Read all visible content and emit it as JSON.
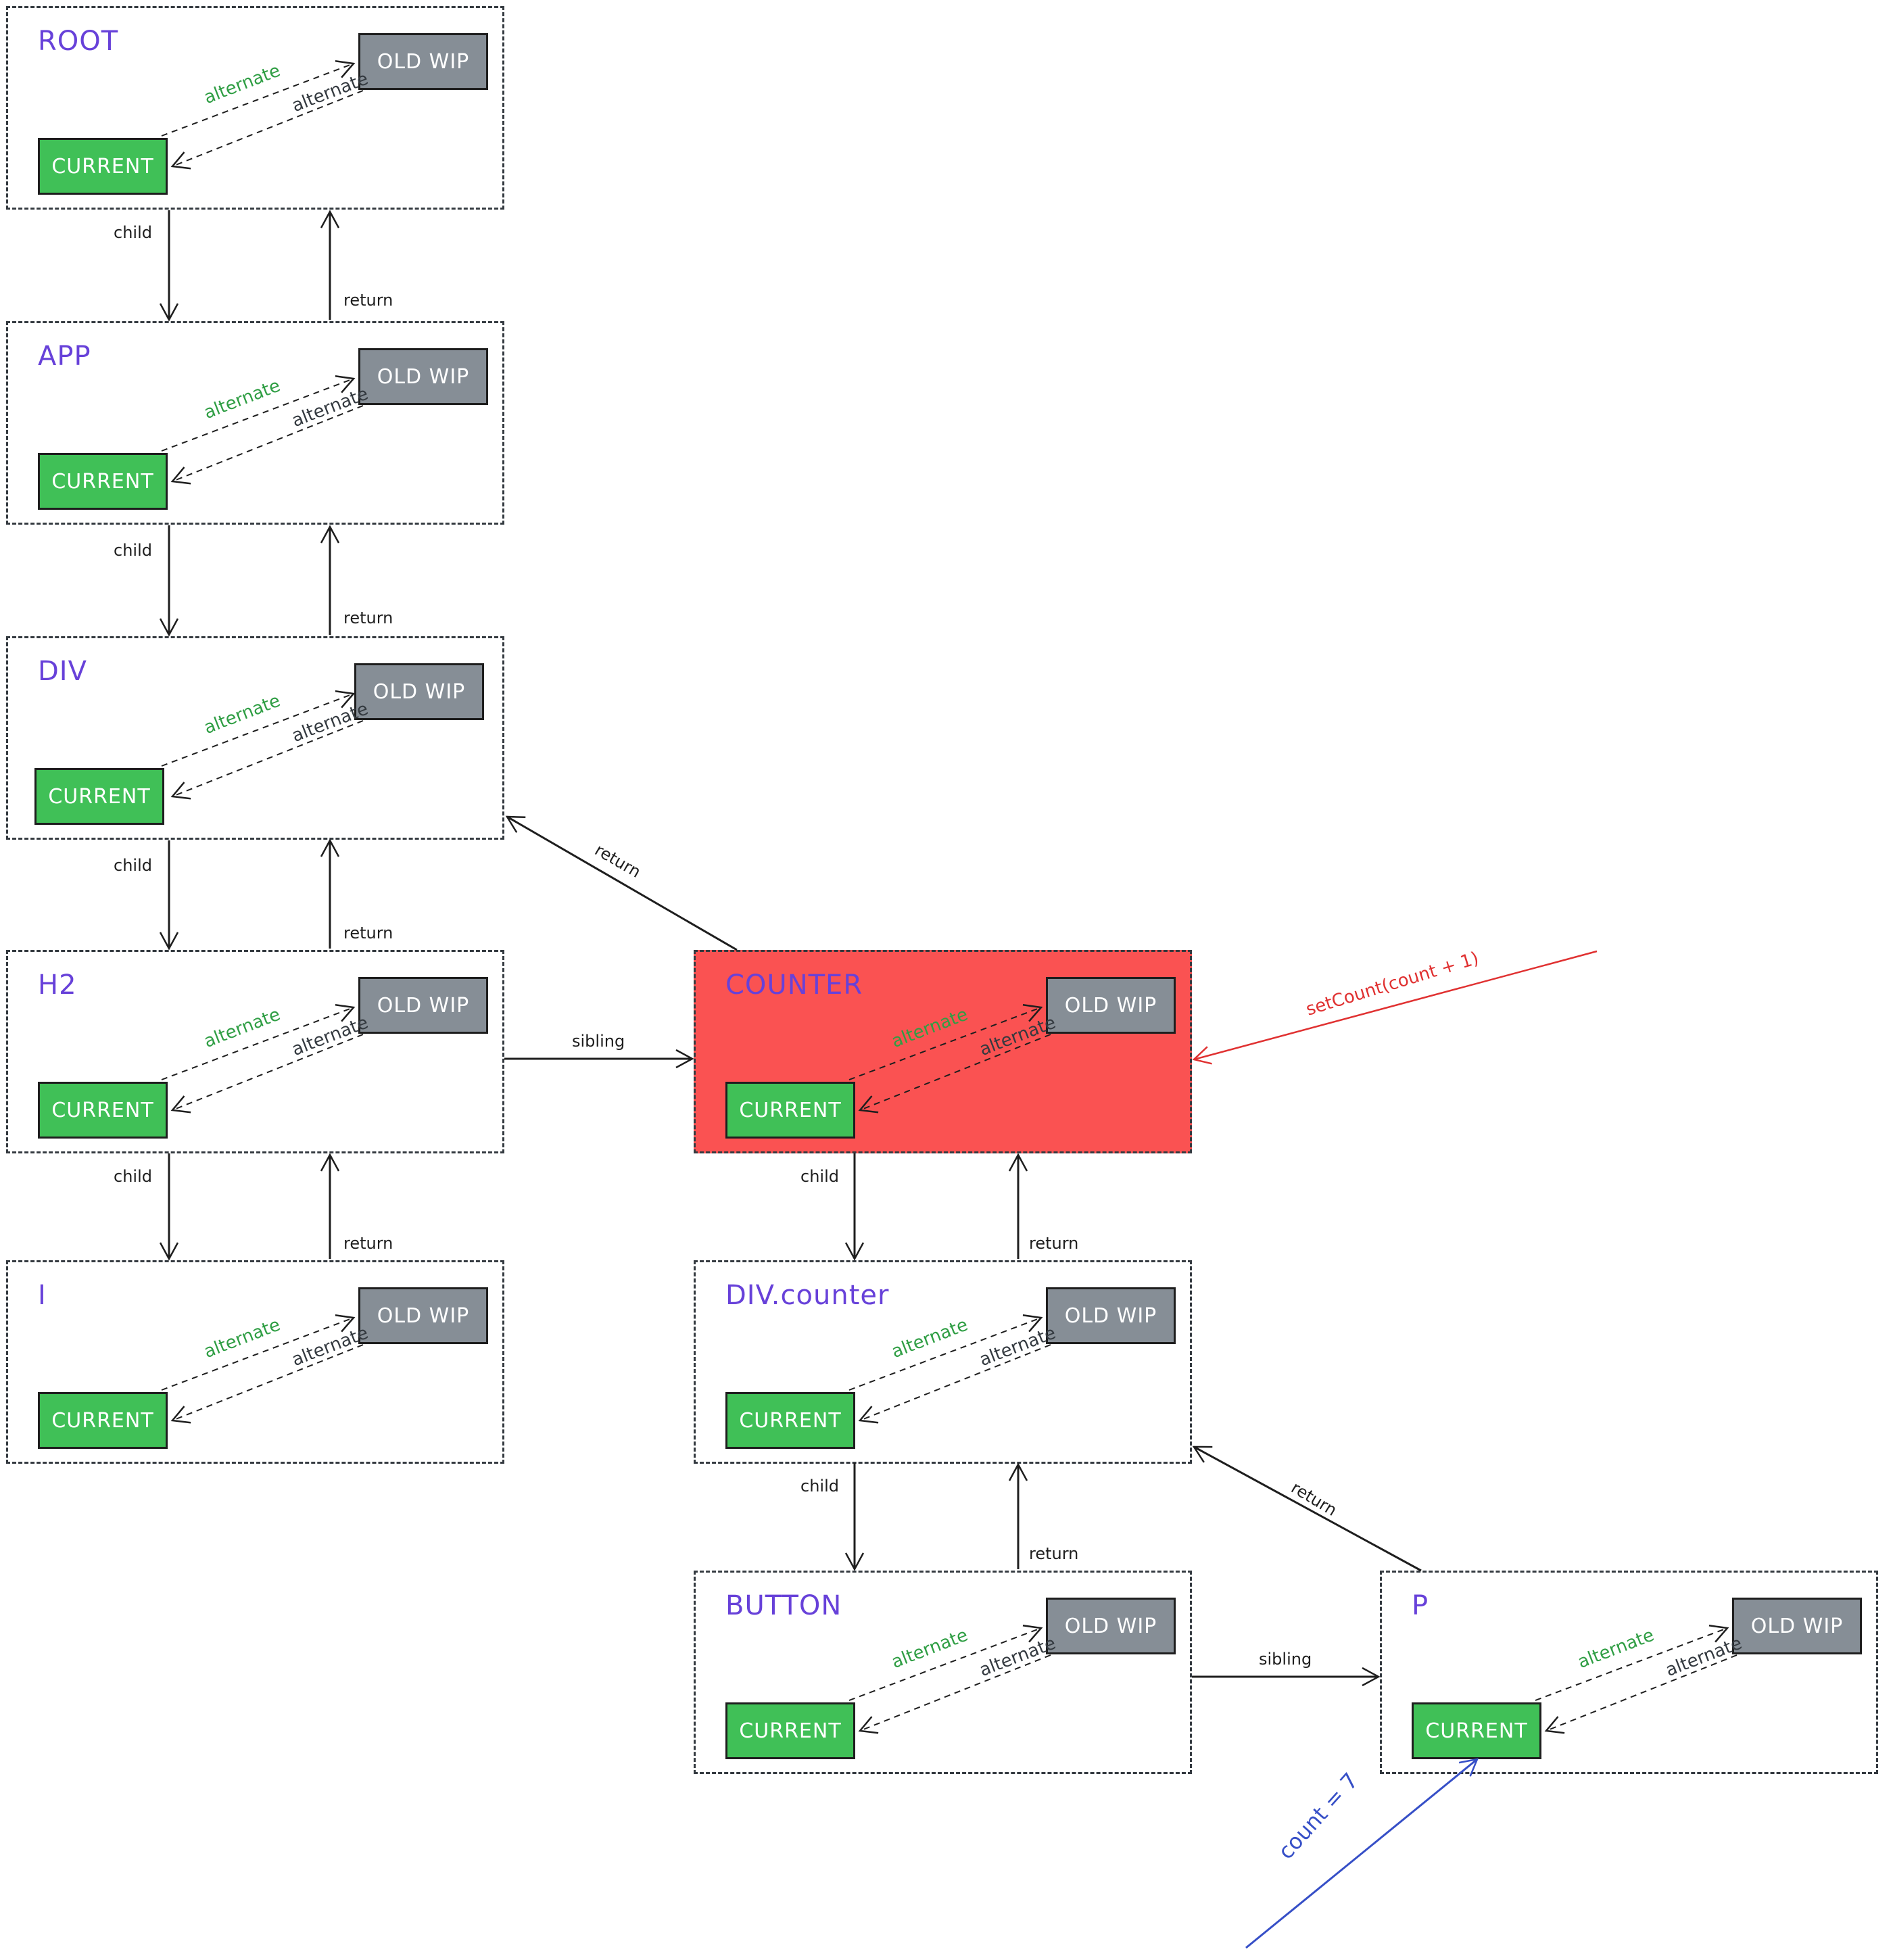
{
  "nodes": [
    {
      "id": "root",
      "label": "ROOT",
      "highlight": false
    },
    {
      "id": "app",
      "label": "APP",
      "highlight": false
    },
    {
      "id": "div",
      "label": "DIV",
      "highlight": false
    },
    {
      "id": "h2",
      "label": "H2",
      "highlight": false
    },
    {
      "id": "i",
      "label": "I",
      "highlight": false
    },
    {
      "id": "counter",
      "label": "COUNTER",
      "highlight": true
    },
    {
      "id": "divcounter",
      "label": "DIV.counter",
      "highlight": false
    },
    {
      "id": "button",
      "label": "BUTTON",
      "highlight": false
    },
    {
      "id": "p",
      "label": "P",
      "highlight": false
    }
  ],
  "fiber_labels": {
    "current": "CURRENT",
    "old_wip": "OLD WIP",
    "alternate_forward": "alternate",
    "alternate_back": "alternate"
  },
  "edges": [
    {
      "from": "root",
      "to": "app",
      "label": "child"
    },
    {
      "from": "app",
      "to": "root",
      "label": "return"
    },
    {
      "from": "app",
      "to": "div",
      "label": "child"
    },
    {
      "from": "div",
      "to": "app",
      "label": "return"
    },
    {
      "from": "div",
      "to": "h2",
      "label": "child"
    },
    {
      "from": "h2",
      "to": "div",
      "label": "return"
    },
    {
      "from": "h2",
      "to": "i",
      "label": "child"
    },
    {
      "from": "i",
      "to": "h2",
      "label": "return"
    },
    {
      "from": "h2",
      "to": "counter",
      "label": "sibling"
    },
    {
      "from": "counter",
      "to": "div",
      "label": "return"
    },
    {
      "from": "counter",
      "to": "divcounter",
      "label": "child"
    },
    {
      "from": "divcounter",
      "to": "counter",
      "label": "return"
    },
    {
      "from": "divcounter",
      "to": "button",
      "label": "child"
    },
    {
      "from": "button",
      "to": "divcounter",
      "label": "return"
    },
    {
      "from": "button",
      "to": "p",
      "label": "sibling"
    },
    {
      "from": "p",
      "to": "divcounter",
      "label": "return"
    }
  ],
  "annotations": {
    "set_count": "setCount(count + 1)",
    "count_value": "count = 7"
  },
  "colors": {
    "current": "#40c057",
    "old_wip": "#868e96",
    "highlight": "#fa5252",
    "node_label": "#6741d9",
    "alternate_green": "#2f9e44",
    "set_count": "#e03131",
    "count_value": "#364fc7"
  }
}
